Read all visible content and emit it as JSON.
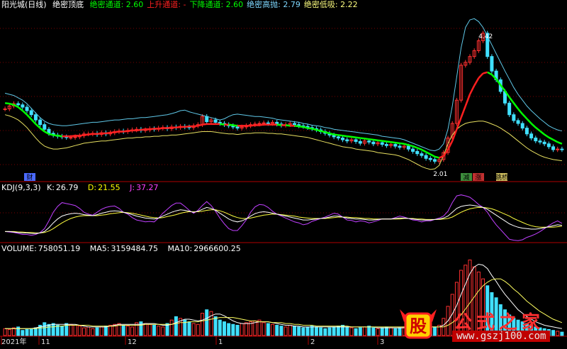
{
  "main_panel": {
    "stock_name": "阳光城",
    "period": "(日线)",
    "indicator": "绝密顶底",
    "params": [
      {
        "label": "绝密通道",
        "value": "2.60",
        "color": "#00ff00"
      },
      {
        "label": "上升通道",
        "value": "-",
        "color": "#ff2020"
      },
      {
        "label": "下降通道",
        "value": "2.60",
        "color": "#00ff00"
      },
      {
        "label": "绝密高抛",
        "value": "2.79",
        "color": "#7fd8ff"
      },
      {
        "label": "绝密低吸",
        "value": "2.22",
        "color": "#ffff80"
      }
    ],
    "markers": {
      "cai": "财",
      "jian": "减",
      "zhang": "涨",
      "tiaoqiao": "跳桥"
    },
    "high_label": "4.42",
    "low_label": "2.01",
    "dash_label": "- - - - - - -"
  },
  "kdj_panel": {
    "name": "KDJ(9,3,3)",
    "k": {
      "label": "K:",
      "value": "26.79",
      "color": "#ffffff"
    },
    "d": {
      "label": "D:",
      "value": "21.55",
      "color": "#ffff00"
    },
    "j": {
      "label": "J:",
      "value": "37.27",
      "color": "#ff40ff"
    }
  },
  "volume_panel": {
    "volume": {
      "label": "VOLUME:",
      "value": "758051.19",
      "color": "#ffffff"
    },
    "ma5": {
      "label": "MA5:",
      "value": "3159484.75",
      "color": "#ffffff"
    },
    "ma10": {
      "label": "MA10:",
      "value": "2966600.25",
      "color": "#ffffff"
    }
  },
  "axis": {
    "labels": [
      "2021年",
      "11",
      "12",
      "1",
      "2",
      "3"
    ]
  },
  "watermark": {
    "logo_char": "股",
    "brand": "公式之家",
    "url": "www.gszj100.com"
  },
  "chart_data": {
    "type": "line",
    "price_closes": [
      3.05,
      3.1,
      3.14,
      3.12,
      3.08,
      3.02,
      2.95,
      2.86,
      2.78,
      2.7,
      2.63,
      2.6,
      2.58,
      2.57,
      2.56,
      2.56,
      2.57,
      2.59,
      2.62,
      2.62,
      2.63,
      2.61,
      2.64,
      2.62,
      2.64,
      2.66,
      2.67,
      2.66,
      2.68,
      2.69,
      2.7,
      2.68,
      2.69,
      2.71,
      2.7,
      2.72,
      2.73,
      2.71,
      2.74,
      2.73,
      2.75,
      2.74,
      2.73,
      2.76,
      2.78,
      2.92,
      2.83,
      2.86,
      2.82,
      2.8,
      2.78,
      2.76,
      2.74,
      2.72,
      2.74,
      2.76,
      2.78,
      2.79,
      2.8,
      2.81,
      2.8,
      2.82,
      2.79,
      2.77,
      2.78,
      2.8,
      2.78,
      2.76,
      2.75,
      2.73,
      2.71,
      2.69,
      2.66,
      2.63,
      2.6,
      2.57,
      2.55,
      2.52,
      2.5,
      2.52,
      2.49,
      2.46,
      2.5,
      2.48,
      2.45,
      2.47,
      2.44,
      2.42,
      2.44,
      2.41,
      2.39,
      2.41,
      2.36,
      2.32,
      2.28,
      2.25,
      2.2,
      2.18,
      2.15,
      2.18,
      2.3,
      2.55,
      2.8,
      3.2,
      3.8,
      3.85,
      3.95,
      4.05,
      4.22,
      4.35,
      3.95,
      3.7,
      3.55,
      3.35,
      3.15,
      2.95,
      2.85,
      2.8,
      2.72,
      2.62,
      2.55,
      2.5,
      2.48,
      2.45,
      2.4,
      2.35,
      2.36,
      2.35
    ],
    "channel_ma": [
      3.15,
      3.14,
      3.12,
      3.08,
      3.02,
      2.95,
      2.87,
      2.79,
      2.72,
      2.66,
      2.62,
      2.6,
      2.59,
      2.58,
      2.58,
      2.58,
      2.59,
      2.59,
      2.6,
      2.61,
      2.62,
      2.62,
      2.63,
      2.63,
      2.64,
      2.65,
      2.66,
      2.66,
      2.67,
      2.68,
      2.68,
      2.69,
      2.7,
      2.7,
      2.71,
      2.71,
      2.72,
      2.72,
      2.73,
      2.73,
      2.74,
      2.74,
      2.75,
      2.75,
      2.76,
      2.78,
      2.79,
      2.79,
      2.79,
      2.79,
      2.78,
      2.78,
      2.77,
      2.76,
      2.76,
      2.76,
      2.76,
      2.77,
      2.77,
      2.78,
      2.78,
      2.78,
      2.78,
      2.77,
      2.77,
      2.76,
      2.76,
      2.75,
      2.74,
      2.72,
      2.71,
      2.69,
      2.67,
      2.65,
      2.63,
      2.61,
      2.6,
      2.59,
      2.58,
      2.57,
      2.56,
      2.55,
      2.54,
      2.53,
      2.52,
      2.51,
      2.5,
      2.49,
      2.48,
      2.47,
      2.46,
      2.45,
      2.43,
      2.41,
      2.38,
      2.35,
      2.31,
      2.27,
      2.23,
      2.21,
      2.24,
      2.35,
      2.5,
      2.7,
      2.9,
      3.1,
      3.3,
      3.45,
      3.58,
      3.66,
      3.68,
      3.64,
      3.56,
      3.46,
      3.36,
      3.25,
      3.15,
      3.05,
      2.96,
      2.88,
      2.8,
      2.73,
      2.67,
      2.61,
      2.56,
      2.52,
      2.48,
      2.45
    ],
    "upper_band": [
      3.32,
      3.3,
      3.28,
      3.24,
      3.2,
      3.14,
      3.06,
      2.98,
      2.9,
      2.84,
      2.8,
      2.78,
      2.77,
      2.76,
      2.76,
      2.77,
      2.78,
      2.79,
      2.8,
      2.81,
      2.82,
      2.82,
      2.83,
      2.84,
      2.85,
      2.86,
      2.86,
      2.87,
      2.88,
      2.88,
      2.89,
      2.9,
      2.9,
      2.91,
      2.92,
      2.93,
      2.94,
      2.95,
      2.97,
      2.99,
      3.02,
      3.03,
      3.0,
      2.98,
      2.96,
      2.94,
      2.92,
      2.9,
      2.88,
      2.86,
      2.88,
      2.92,
      2.95,
      2.96,
      2.95,
      2.94,
      2.93,
      2.92,
      2.92,
      2.91,
      2.9,
      2.89,
      2.87,
      2.86,
      2.85,
      2.84,
      2.83,
      2.82,
      2.8,
      2.79,
      2.77,
      2.76,
      2.75,
      2.73,
      2.72,
      2.7,
      2.69,
      2.68,
      2.67,
      2.66,
      2.65,
      2.64,
      2.63,
      2.62,
      2.61,
      2.6,
      2.58,
      2.57,
      2.56,
      2.55,
      2.54,
      2.52,
      2.49,
      2.46,
      2.43,
      2.4,
      2.37,
      2.34,
      2.33,
      2.36,
      2.45,
      2.7,
      3.1,
      3.6,
      4.1,
      4.45,
      4.58,
      4.6,
      4.55,
      4.45,
      4.3,
      4.15,
      4.0,
      3.85,
      3.7,
      3.56,
      3.42,
      3.3,
      3.2,
      3.1,
      3.02,
      2.95,
      2.88,
      2.82,
      2.76,
      2.72,
      2.69,
      2.67
    ],
    "lower_band": [
      2.95,
      2.93,
      2.9,
      2.86,
      2.8,
      2.73,
      2.64,
      2.55,
      2.47,
      2.41,
      2.38,
      2.36,
      2.36,
      2.37,
      2.38,
      2.4,
      2.42,
      2.44,
      2.46,
      2.47,
      2.48,
      2.49,
      2.5,
      2.5,
      2.51,
      2.52,
      2.53,
      2.54,
      2.55,
      2.55,
      2.56,
      2.56,
      2.57,
      2.57,
      2.58,
      2.58,
      2.59,
      2.59,
      2.6,
      2.6,
      2.61,
      2.62,
      2.63,
      2.64,
      2.65,
      2.66,
      2.66,
      2.66,
      2.65,
      2.64,
      2.63,
      2.62,
      2.62,
      2.61,
      2.62,
      2.63,
      2.63,
      2.64,
      2.64,
      2.64,
      2.63,
      2.63,
      2.62,
      2.62,
      2.61,
      2.6,
      2.59,
      2.58,
      2.57,
      2.56,
      2.54,
      2.52,
      2.5,
      2.48,
      2.46,
      2.44,
      2.42,
      2.4,
      2.39,
      2.38,
      2.36,
      2.35,
      2.34,
      2.33,
      2.32,
      2.3,
      2.29,
      2.28,
      2.27,
      2.26,
      2.24,
      2.21,
      2.18,
      2.14,
      2.1,
      2.06,
      2.03,
      2.01,
      2.02,
      2.08,
      2.25,
      2.45,
      2.6,
      2.7,
      2.76,
      2.8,
      2.82,
      2.83,
      2.84,
      2.84,
      2.82,
      2.79,
      2.76,
      2.72,
      2.67,
      2.62,
      2.56,
      2.5,
      2.44,
      2.38,
      2.33,
      2.29,
      2.25,
      2.22,
      2.2,
      2.18,
      2.17,
      2.16
    ],
    "kdj_k": [
      20,
      20,
      19,
      18,
      17,
      17,
      16,
      16,
      17,
      20,
      28,
      38,
      46,
      52,
      55,
      57,
      58,
      57,
      55,
      54,
      53,
      55,
      58,
      60,
      62,
      63,
      62,
      60,
      58,
      55,
      52,
      50,
      48,
      47,
      46,
      48,
      52,
      56,
      60,
      63,
      65,
      64,
      62,
      60,
      62,
      66,
      70,
      68,
      64,
      58,
      52,
      46,
      42,
      40,
      42,
      46,
      52,
      57,
      60,
      61,
      60,
      58,
      56,
      54,
      52,
      50,
      48,
      46,
      44,
      44,
      45,
      46,
      47,
      48,
      50,
      52,
      52,
      50,
      48,
      47,
      46,
      46,
      45,
      44,
      44,
      45,
      46,
      46,
      46,
      47,
      48,
      48,
      47,
      46,
      45,
      44,
      44,
      44,
      45,
      46,
      48,
      52,
      60,
      68,
      72,
      74,
      75,
      74,
      72,
      70,
      66,
      60,
      54,
      48,
      42,
      36,
      32,
      29,
      27,
      26,
      25,
      25,
      26,
      28,
      30,
      32,
      34,
      33
    ],
    "kdj_d": [
      20,
      20,
      20,
      19,
      19,
      18,
      18,
      17,
      17,
      18,
      21,
      26,
      32,
      38,
      43,
      47,
      50,
      52,
      53,
      53,
      53,
      53,
      54,
      55,
      57,
      58,
      59,
      60,
      59,
      58,
      56,
      54,
      52,
      50,
      49,
      48,
      49,
      51,
      53,
      55,
      58,
      60,
      61,
      61,
      61,
      62,
      64,
      65,
      65,
      63,
      60,
      56,
      52,
      49,
      47,
      47,
      48,
      50,
      52,
      54,
      55,
      56,
      56,
      55,
      54,
      53,
      52,
      50,
      49,
      48,
      47,
      47,
      47,
      47,
      48,
      49,
      50,
      50,
      50,
      49,
      49,
      48,
      47,
      47,
      46,
      46,
      46,
      46,
      46,
      46,
      46,
      47,
      47,
      47,
      46,
      46,
      45,
      45,
      45,
      45,
      46,
      47,
      50,
      55,
      60,
      64,
      67,
      69,
      70,
      70,
      69,
      67,
      64,
      60,
      56,
      52,
      47,
      43,
      39,
      35,
      32,
      30,
      29,
      29,
      29,
      29,
      30,
      31
    ],
    "kdj_j": [
      20,
      19,
      18,
      16,
      14,
      14,
      12,
      14,
      18,
      26,
      42,
      60,
      72,
      80,
      78,
      76,
      74,
      68,
      60,
      56,
      54,
      60,
      66,
      70,
      72,
      73,
      68,
      60,
      56,
      49,
      44,
      42,
      40,
      41,
      40,
      48,
      58,
      66,
      74,
      79,
      79,
      72,
      64,
      58,
      64,
      74,
      82,
      74,
      62,
      48,
      36,
      26,
      22,
      22,
      32,
      44,
      60,
      71,
      76,
      75,
      70,
      62,
      56,
      52,
      48,
      44,
      40,
      38,
      34,
      36,
      41,
      44,
      47,
      50,
      54,
      58,
      56,
      50,
      44,
      43,
      40,
      42,
      41,
      38,
      40,
      43,
      46,
      46,
      46,
      49,
      52,
      50,
      47,
      44,
      43,
      40,
      42,
      42,
      45,
      48,
      52,
      62,
      80,
      94,
      96,
      94,
      91,
      84,
      76,
      70,
      60,
      46,
      34,
      24,
      14,
      4,
      2,
      1,
      3,
      8,
      11,
      15,
      20,
      26,
      32,
      38,
      42,
      37
    ],
    "volume": [
      8,
      7,
      9,
      10,
      6,
      7,
      8,
      9,
      12,
      15,
      13,
      14,
      12,
      11,
      14,
      13,
      12,
      11,
      9,
      10,
      8,
      9,
      10,
      11,
      12,
      13,
      14,
      12,
      11,
      10,
      15,
      16,
      14,
      13,
      12,
      11,
      10,
      14,
      18,
      22,
      20,
      18,
      16,
      14,
      13,
      26,
      30,
      28,
      22,
      18,
      16,
      14,
      13,
      12,
      14,
      15,
      16,
      17,
      18,
      15,
      14,
      13,
      12,
      11,
      10,
      12,
      11,
      10,
      9,
      10,
      11,
      10,
      9,
      8,
      9,
      10,
      11,
      12,
      10,
      9,
      8,
      9,
      10,
      11,
      9,
      8,
      9,
      10,
      9,
      8,
      9,
      10,
      11,
      12,
      10,
      9,
      8,
      9,
      10,
      12,
      20,
      34,
      48,
      62,
      76,
      82,
      88,
      80,
      74,
      66,
      58,
      50,
      44,
      36,
      30,
      24,
      20,
      18,
      16,
      14,
      12,
      10,
      9,
      8,
      7,
      6,
      5,
      4
    ],
    "ma5": [
      8,
      8,
      8,
      8,
      8,
      8,
      8,
      9,
      10,
      11,
      12,
      13,
      13,
      13,
      13,
      13,
      13,
      12,
      11,
      10,
      10,
      10,
      10,
      10,
      11,
      12,
      13,
      13,
      13,
      13,
      13,
      13,
      14,
      14,
      14,
      13,
      12,
      12,
      13,
      15,
      17,
      19,
      19,
      18,
      17,
      18,
      20,
      23,
      25,
      25,
      23,
      20,
      17,
      15,
      14,
      14,
      14,
      15,
      16,
      16,
      16,
      15,
      14,
      13,
      12,
      12,
      11,
      11,
      10,
      10,
      10,
      10,
      10,
      10,
      10,
      10,
      10,
      10,
      10,
      10,
      10,
      10,
      10,
      10,
      10,
      9,
      9,
      9,
      9,
      9,
      9,
      9,
      10,
      10,
      10,
      10,
      10,
      10,
      10,
      10,
      12,
      17,
      25,
      35,
      48,
      60,
      72,
      80,
      83,
      82,
      78,
      70,
      63,
      55,
      48,
      42,
      36,
      30,
      26,
      22,
      19,
      16,
      14,
      12,
      11,
      10,
      9,
      8
    ],
    "ma10": [
      8,
      8,
      8,
      8,
      8,
      8,
      8,
      8,
      9,
      9,
      10,
      10,
      11,
      11,
      12,
      12,
      12,
      12,
      12,
      12,
      11,
      11,
      11,
      11,
      11,
      11,
      12,
      12,
      12,
      12,
      12,
      12,
      13,
      13,
      13,
      13,
      13,
      13,
      13,
      14,
      15,
      15,
      16,
      16,
      16,
      17,
      18,
      19,
      20,
      21,
      21,
      21,
      21,
      20,
      19,
      18,
      17,
      17,
      16,
      16,
      16,
      15,
      15,
      15,
      14,
      14,
      13,
      13,
      12,
      12,
      12,
      11,
      11,
      11,
      11,
      11,
      11,
      11,
      11,
      10,
      10,
      10,
      10,
      10,
      10,
      10,
      10,
      10,
      10,
      10,
      10,
      10,
      10,
      10,
      10,
      10,
      10,
      10,
      10,
      10,
      10,
      12,
      15,
      19,
      24,
      31,
      38,
      45,
      52,
      58,
      62,
      65,
      66,
      66,
      63,
      59,
      54,
      50,
      45,
      40,
      36,
      32,
      28,
      25,
      22,
      19,
      17,
      15
    ]
  }
}
